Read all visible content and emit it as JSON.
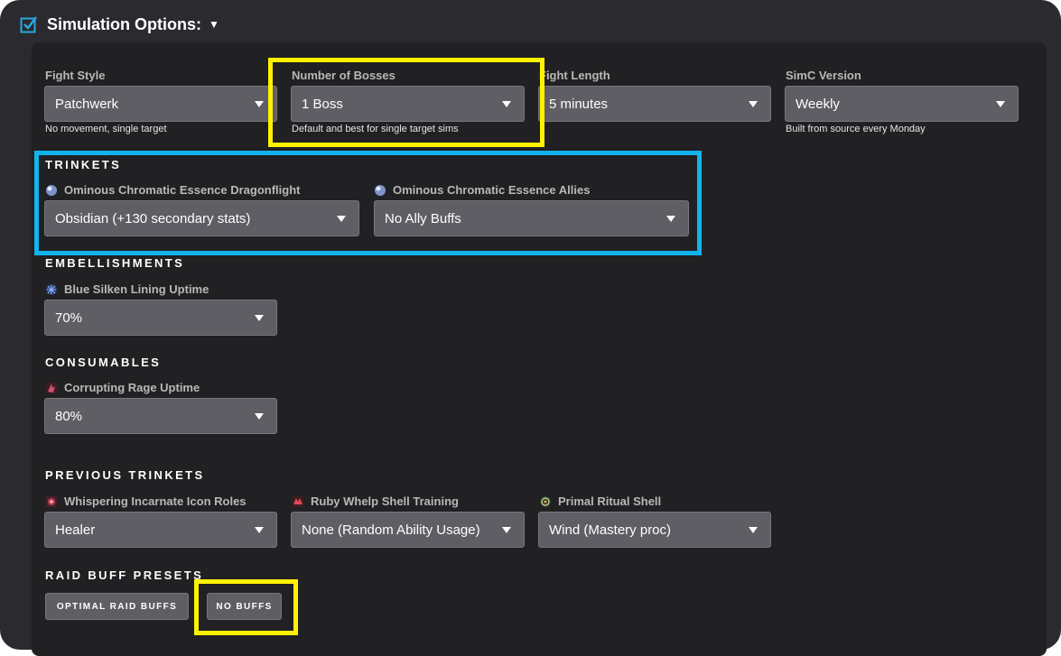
{
  "header": {
    "title": "Simulation Options:",
    "caret": "▼"
  },
  "fight": {
    "fight_style": {
      "label": "Fight Style",
      "value": "Patchwerk",
      "helper": "No movement, single target"
    },
    "bosses": {
      "label": "Number of Bosses",
      "value": "1 Boss",
      "helper": "Default and best for single target sims"
    },
    "fight_length": {
      "label": "Fight Length",
      "value": "5 minutes"
    },
    "simc_version": {
      "label": "SimC Version",
      "value": "Weekly",
      "helper": "Built from source every Monday"
    }
  },
  "trinkets": {
    "title": "TRINKETS",
    "essence_dragonflight": {
      "label": "Ominous Chromatic Essence Dragonflight",
      "value": "Obsidian (+130 secondary stats)",
      "icon": "orb-icon"
    },
    "essence_allies": {
      "label": "Ominous Chromatic Essence Allies",
      "value": "No Ally Buffs",
      "icon": "orb-icon"
    }
  },
  "embellishments": {
    "title": "EMBELLISHMENTS",
    "silken_lining": {
      "label": "Blue Silken Lining Uptime",
      "value": "70%",
      "icon": "silk-icon"
    }
  },
  "consumables": {
    "title": "CONSUMABLES",
    "corrupting_rage": {
      "label": "Corrupting Rage Uptime",
      "value": "80%",
      "icon": "rage-icon"
    }
  },
  "previous_trinkets": {
    "title": "PREVIOUS TRINKETS",
    "whispering": {
      "label": "Whispering Incarnate Icon Roles",
      "value": "Healer",
      "icon": "whispering-icon"
    },
    "ruby_whelp": {
      "label": "Ruby Whelp Shell Training",
      "value": "None (Random Ability Usage)",
      "icon": "whelp-icon"
    },
    "primal_ritual": {
      "label": "Primal Ritual Shell",
      "value": "Wind (Mastery proc)",
      "icon": "ritual-shell-icon"
    }
  },
  "raid_buffs": {
    "title": "RAID BUFF PRESETS",
    "optimal": "OPTIMAL RAID BUFFS",
    "none": "NO BUFFS"
  },
  "colors": {
    "highlight_yellow": "#fff200",
    "highlight_blue": "#11b3ee",
    "accent_check": "#2aa8e0"
  }
}
